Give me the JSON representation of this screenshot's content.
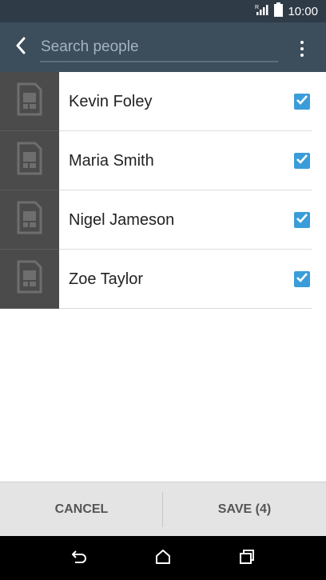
{
  "status_bar": {
    "time": "10:00",
    "signal_icon": "signal-icon",
    "battery_icon": "battery-icon"
  },
  "search": {
    "placeholder": "Search people",
    "value": ""
  },
  "contacts": [
    {
      "name": "Kevin Foley",
      "checked": true,
      "avatar_icon": "sim-card-icon"
    },
    {
      "name": "Maria Smith",
      "checked": true,
      "avatar_icon": "sim-card-icon"
    },
    {
      "name": "Nigel Jameson",
      "checked": true,
      "avatar_icon": "sim-card-icon"
    },
    {
      "name": "Zoe Taylor",
      "checked": true,
      "avatar_icon": "sim-card-icon"
    }
  ],
  "actions": {
    "cancel_label": "CANCEL",
    "save_label": "SAVE (4)"
  },
  "nav": {
    "back_icon": "back-icon",
    "home_icon": "home-icon",
    "recents_icon": "recents-icon"
  },
  "colors": {
    "header_bg": "#3c4d5c",
    "status_bg": "#2f3b47",
    "checkbox": "#3a9dd9",
    "avatar_bg": "#4b4b4b",
    "action_bar_bg": "#e4e4e4"
  }
}
